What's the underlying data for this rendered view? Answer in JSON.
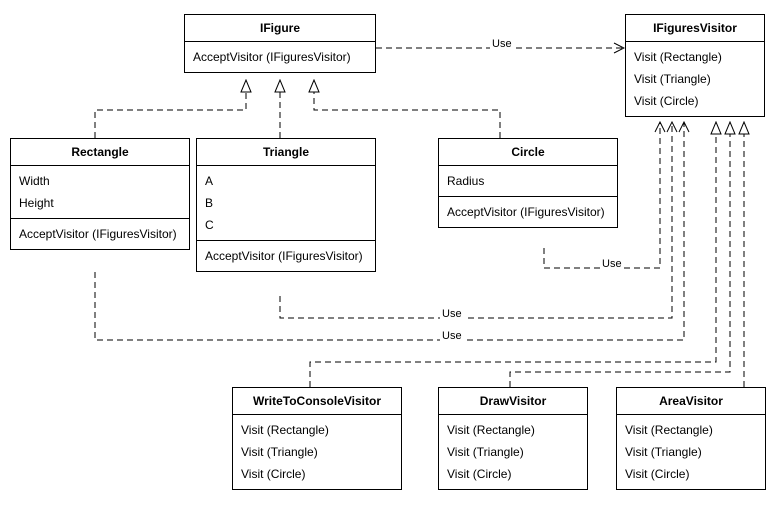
{
  "classes": {
    "ifigure": {
      "title": "IFigure",
      "methods": [
        "AcceptVisitor (IFiguresVisitor)"
      ]
    },
    "ifiguresvisitor": {
      "title": "IFiguresVisitor",
      "methods": [
        "Visit (Rectangle)",
        "Visit (Triangle)",
        "Visit (Circle)"
      ]
    },
    "rectangle": {
      "title": "Rectangle",
      "attrs": [
        "Width",
        "Height"
      ],
      "methods": [
        "AcceptVisitor (IFiguresVisitor)"
      ]
    },
    "triangle": {
      "title": "Triangle",
      "attrs": [
        "A",
        "B",
        "C"
      ],
      "methods": [
        "AcceptVisitor (IFiguresVisitor)"
      ]
    },
    "circle": {
      "title": "Circle",
      "attrs": [
        "Radius"
      ],
      "methods": [
        "AcceptVisitor (IFiguresVisitor)"
      ]
    },
    "writetoconsolevisitor": {
      "title": "WriteToConsoleVisitor",
      "methods": [
        "Visit (Rectangle)",
        "Visit (Triangle)",
        "Visit (Circle)"
      ]
    },
    "drawvisitor": {
      "title": "DrawVisitor",
      "methods": [
        "Visit (Rectangle)",
        "Visit (Triangle)",
        "Visit (Circle)"
      ]
    },
    "areavisitor": {
      "title": "AreaVisitor",
      "methods": [
        "Visit (Rectangle)",
        "Visit (Triangle)",
        "Visit (Circle)"
      ]
    }
  },
  "edge_labels": {
    "ifigure_to_ifiguresvisitor": "Use",
    "circle_to_ifiguresvisitor": "Use",
    "triangle_to_ifiguresvisitor": "Use",
    "rectangle_to_ifiguresvisitor": "Use"
  },
  "chart_data": {
    "type": "table",
    "description": "UML class diagram: Visitor design pattern over geometric figures",
    "interfaces": [
      "IFigure",
      "IFiguresVisitor"
    ],
    "classes": {
      "IFigure": {
        "kind": "interface",
        "methods": [
          "AcceptVisitor(IFiguresVisitor)"
        ]
      },
      "IFiguresVisitor": {
        "kind": "interface",
        "methods": [
          "Visit(Rectangle)",
          "Visit(Triangle)",
          "Visit(Circle)"
        ]
      },
      "Rectangle": {
        "kind": "class",
        "attrs": [
          "Width",
          "Height"
        ],
        "methods": [
          "AcceptVisitor(IFiguresVisitor)"
        ]
      },
      "Triangle": {
        "kind": "class",
        "attrs": [
          "A",
          "B",
          "C"
        ],
        "methods": [
          "AcceptVisitor(IFiguresVisitor)"
        ]
      },
      "Circle": {
        "kind": "class",
        "attrs": [
          "Radius"
        ],
        "methods": [
          "AcceptVisitor(IFiguresVisitor)"
        ]
      },
      "WriteToConsoleVisitor": {
        "kind": "class",
        "methods": [
          "Visit(Rectangle)",
          "Visit(Triangle)",
          "Visit(Circle)"
        ]
      },
      "DrawVisitor": {
        "kind": "class",
        "methods": [
          "Visit(Rectangle)",
          "Visit(Triangle)",
          "Visit(Circle)"
        ]
      },
      "AreaVisitor": {
        "kind": "class",
        "methods": [
          "Visit(Rectangle)",
          "Visit(Triangle)",
          "Visit(Circle)"
        ]
      }
    },
    "relationships": [
      {
        "from": "Rectangle",
        "to": "IFigure",
        "type": "realization"
      },
      {
        "from": "Triangle",
        "to": "IFigure",
        "type": "realization"
      },
      {
        "from": "Circle",
        "to": "IFigure",
        "type": "realization"
      },
      {
        "from": "WriteToConsoleVisitor",
        "to": "IFiguresVisitor",
        "type": "realization"
      },
      {
        "from": "DrawVisitor",
        "to": "IFiguresVisitor",
        "type": "realization"
      },
      {
        "from": "AreaVisitor",
        "to": "IFiguresVisitor",
        "type": "realization"
      },
      {
        "from": "IFigure",
        "to": "IFiguresVisitor",
        "type": "dependency",
        "label": "Use"
      },
      {
        "from": "Circle",
        "to": "IFiguresVisitor",
        "type": "dependency",
        "label": "Use"
      },
      {
        "from": "Triangle",
        "to": "IFiguresVisitor",
        "type": "dependency",
        "label": "Use"
      },
      {
        "from": "Rectangle",
        "to": "IFiguresVisitor",
        "type": "dependency",
        "label": "Use"
      }
    ]
  }
}
